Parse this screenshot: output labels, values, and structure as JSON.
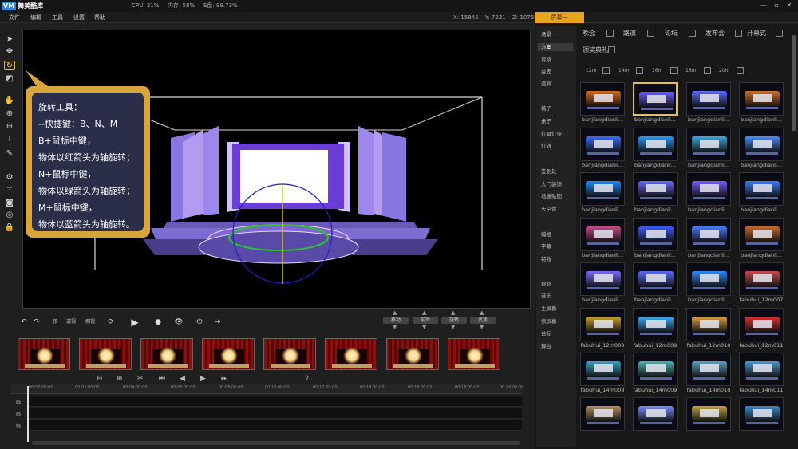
{
  "app": {
    "logo_mark": "VM",
    "name": "舞美酷库"
  },
  "status": {
    "cpu": "CPU: 31%",
    "memory": "内存: 58%",
    "disk": "E盘: 99.73%"
  },
  "window_controls": {
    "minimize": "—",
    "restore": "▫",
    "close": "✕"
  },
  "menu": {
    "items": [
      "文件",
      "编辑",
      "工具",
      "设置",
      "帮助"
    ]
  },
  "coords": {
    "x": "X: 15845",
    "y": "Y: 7231",
    "z": "Z: 10766"
  },
  "screen_tab": "屏幕一",
  "tools": [
    "select-arrow-icon",
    "move-icon",
    "rotate-icon",
    "scale-icon",
    "hand-icon",
    "zoom-in-icon",
    "zoom-out-icon",
    "text-icon",
    "edit-icon",
    "settings-icon",
    "grid-icon",
    "camera-icon",
    "target-icon",
    "lock-icon"
  ],
  "callout": {
    "lines": [
      "旋转工具：",
      "   --快捷键：B、N、M",
      "B+鼠标中键，",
      "物体以红箭头为轴旋转；",
      "N+鼠标中键，",
      "物体以绿箭头为轴旋转；",
      "M+鼠标中键，",
      "物体以蓝箭头为轴旋转。"
    ]
  },
  "controls": {
    "undo": "↶",
    "redo": "↷",
    "view_top": "顶",
    "view_persp": "透视",
    "view_side": "侧视",
    "play": "▶",
    "record": "●",
    "eye": "👁",
    "power": "⏻",
    "forward": "➜"
  },
  "pads": [
    {
      "label": "移动"
    },
    {
      "label": "前后"
    },
    {
      "label": "旋转"
    },
    {
      "label": "变焦"
    }
  ],
  "timeline": {
    "ticks": [
      "00:00:00:00",
      "00:02:00:00",
      "00:04:00:00",
      "00:06:00:00",
      "00:08:00:00",
      "00:10:00:00",
      "00:12:00:00",
      "00:14:00:00",
      "00:16:00:00",
      "00:18:00:00",
      "00:20:00:00"
    ],
    "zoom_in": "⊖",
    "zoom_out": "⊕",
    "cut": "✂",
    "prev": "⏮",
    "step_back": "◀",
    "step_fwd": "▶",
    "next": "⏭",
    "export": "⇪"
  },
  "categories": {
    "group1": [
      "场景",
      "方案",
      "背景",
      "台面",
      "道具"
    ],
    "group2": [
      "椅子",
      "桌子",
      "灯具灯架",
      "灯效"
    ],
    "group3": [
      "签到处",
      "大门装饰",
      "地板贴图",
      "天空体"
    ],
    "group4": [
      "编组",
      "字幕",
      "特效"
    ],
    "group5": [
      "视频",
      "音乐",
      "主屏幕",
      "侧屏幕",
      "台标",
      "舞台"
    ],
    "selected": "方案"
  },
  "filters": {
    "types": [
      "晚会",
      "路演",
      "论坛",
      "发布会",
      "开幕式",
      "颁奖典礼"
    ],
    "sizes": [
      "12m",
      "14m",
      "16m",
      "18m",
      "20m"
    ]
  },
  "thumbnails": [
    "",
    "",
    "",
    "",
    "banjiangdianli...",
    "banjiangdianli...",
    "banjiangdianli...",
    "banjiangdianli...",
    "banjiangdianli...",
    "banjiangdianli...",
    "banjiangdianli...",
    "banjiangdianli...",
    "banjiangdianli...",
    "banjiangdianli...",
    "banjiangdianli...",
    "banjiangdianli...",
    "banjiangdianli...",
    "banjiangdianli...",
    "banjiangdianli...",
    "banjiangdianli...",
    "banjiangdianli...",
    "banjiangdianli...",
    "banjiangdianli...",
    "fabuhui_12m007",
    "fabuhui_12m008",
    "fabuhui_12m009",
    "fabuhui_12m010",
    "fabuhui_12m011",
    "fabuhui_14m008",
    "fabuhui_14m009",
    "fabuhui_14m010",
    "fabuhui_14m011",
    "fabuhui_14m012",
    "fabuhui_14m013",
    "fabuhui_14m016",
    "fabuhui_16m..."
  ],
  "thumb_colors": [
    "#d86a1a",
    "#6a5cff",
    "#5a6cff",
    "#d4702a",
    "#3a6cff",
    "#2a9aff",
    "#3aaae0",
    "#4a8cff",
    "#1a8cff",
    "#6a6aff",
    "#7a5aff",
    "#3a7cff",
    "#c84a8a",
    "#3a5aff",
    "#4a7aff",
    "#c86a2a",
    "#7a6aff",
    "#5a6aff",
    "#2a8aff",
    "#c84a4a",
    "#c8a02a",
    "#3ab0ff",
    "#e0a040",
    "#e03030",
    "#3aa0c0",
    "#50b0b0",
    "#60a0c0",
    "#4a9ad0",
    "#b09060",
    "#7a8aff",
    "#c0a040",
    "#3a8acc"
  ]
}
